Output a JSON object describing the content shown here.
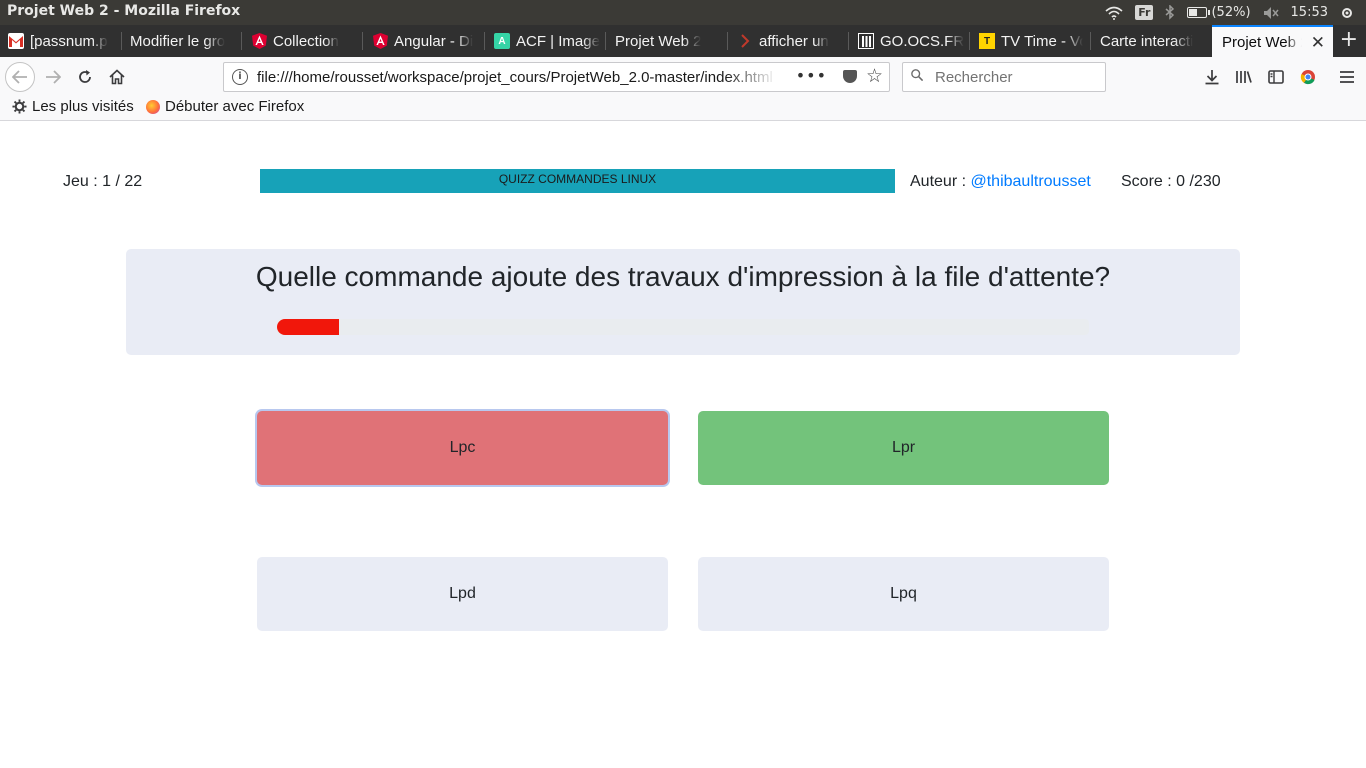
{
  "system_bar": {
    "window_title": "Projet Web 2 - Mozilla Firefox",
    "keyboard_layout": "Fr",
    "battery": "(52%)",
    "clock": "15:53"
  },
  "tabs": [
    {
      "label": "[passnum.p",
      "icon": "gmail-icon",
      "icon_color": "#d93025"
    },
    {
      "label": "Modifier le gro",
      "icon": "",
      "icon_color": ""
    },
    {
      "label": "Collection",
      "icon": "angular-icon",
      "icon_color": "#dd0031"
    },
    {
      "label": "Angular - Di",
      "icon": "angular-icon",
      "icon_color": "#dd0031"
    },
    {
      "label": "ACF | Image",
      "icon": "acf-icon",
      "icon_color": "#35d4a6"
    },
    {
      "label": "Projet Web 2",
      "icon": "",
      "icon_color": ""
    },
    {
      "label": "afficher un",
      "icon": "stackoverflow-icon",
      "icon_color": "#f48024"
    },
    {
      "label": "GO.OCS.FR",
      "icon": "ocs-icon",
      "icon_color": "#ffffff"
    },
    {
      "label": "TV Time - Vo",
      "icon": "tvtime-icon",
      "icon_color": "#ffd400"
    },
    {
      "label": "Carte interacti",
      "icon": "",
      "icon_color": ""
    },
    {
      "label": "Projet Web 2",
      "icon": "",
      "icon_color": "",
      "active": true
    }
  ],
  "navbar": {
    "url": "file:///home/rousset/workspace/projet_cours/ProjetWeb_2.0-master/index.html",
    "search_placeholder": "Rechercher"
  },
  "bookmarks": [
    {
      "label": "Les plus visités",
      "icon": "gear-icon"
    },
    {
      "label": "Débuter avec Firefox",
      "icon": "firefox-icon"
    }
  ],
  "quiz": {
    "game_counter": "Jeu : 1 / 22",
    "banner": "QUIZZ COMMANDES LINUX",
    "author_label": "Auteur : ",
    "author_handle": "@thibaultrousset",
    "score": "Score : 0 /230",
    "question": "Quelle commande ajoute des travaux d'impression à la file d'attente?",
    "timer_fraction": 0.076,
    "answers": [
      {
        "label": "Lpc",
        "state": "wrong",
        "color": "#e07277"
      },
      {
        "label": "Lpr",
        "state": "correct",
        "color": "#73c37b"
      },
      {
        "label": "Lpd",
        "state": "neutral",
        "color": "#e9ecf5"
      },
      {
        "label": "Lpq",
        "state": "neutral",
        "color": "#e9ecf5"
      }
    ],
    "colors": {
      "banner": "#17a2b8",
      "timer": "#f1170b",
      "link": "#007bff"
    }
  }
}
